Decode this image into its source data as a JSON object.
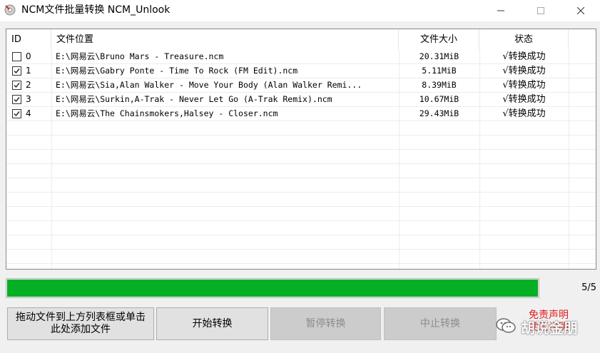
{
  "window": {
    "title": "NCM文件批量转换 NCM_Unlook",
    "icon": "ncm-app-icon"
  },
  "table": {
    "headers": {
      "id": "ID",
      "path": "文件位置",
      "size": "文件大小",
      "status": "状态"
    },
    "rows": [
      {
        "checked": false,
        "id": "0",
        "path": "E:\\网易云\\Bruno Mars - Treasure.ncm",
        "size": "20.31MiB",
        "status": "√转换成功"
      },
      {
        "checked": true,
        "id": "1",
        "path": "E:\\网易云\\Gabry Ponte - Time To Rock (FM Edit).ncm",
        "size": "5.11MiB",
        "status": "√转换成功"
      },
      {
        "checked": true,
        "id": "2",
        "path": "E:\\网易云\\Sia,Alan Walker - Move Your Body (Alan Walker Remi...",
        "size": "8.39MiB",
        "status": "√转换成功"
      },
      {
        "checked": true,
        "id": "3",
        "path": "E:\\网易云\\Surkin,A-Trak - Never Let Go (A-Trak Remix).ncm",
        "size": "10.67MiB",
        "status": "√转换成功"
      },
      {
        "checked": true,
        "id": "4",
        "path": "E:\\网易云\\The Chainsmokers,Halsey - Closer.ncm",
        "size": "29.43MiB",
        "status": "√转换成功"
      }
    ]
  },
  "progress": {
    "fraction": 1.0,
    "text": "5/5",
    "color": "#06b025"
  },
  "buttons": {
    "add_line1": "拖动文件到上方列表框或单击",
    "add_line2": "此处添加文件",
    "start": "开始转换",
    "pause": "暂停转换",
    "stop": "中止转换"
  },
  "disclaimer": {
    "line1": "免责声明",
    "line2": "使用说明",
    "color": "#e02020"
  },
  "watermark": {
    "text": "胡说金朋",
    "icon": "wechat-icon"
  }
}
